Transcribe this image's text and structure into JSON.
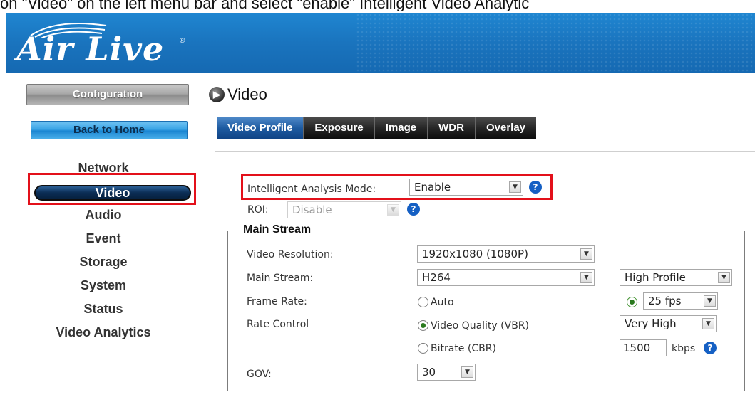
{
  "caption": "on \"Video\" on the left menu bar and select \"enable\" Intelligent Video Analytic",
  "brand": {
    "logo_text": "Air Live",
    "trademark": "®"
  },
  "sidebar": {
    "configuration_label": "Configuration",
    "back_home_label": "Back to Home",
    "items": [
      {
        "label": "Network"
      },
      {
        "label": "Video"
      },
      {
        "label": "Audio"
      },
      {
        "label": "Event"
      },
      {
        "label": "Storage"
      },
      {
        "label": "System"
      },
      {
        "label": "Status"
      },
      {
        "label": "Video Analytics"
      }
    ]
  },
  "page": {
    "title": "Video",
    "tabs": [
      {
        "label": "Video Profile"
      },
      {
        "label": "Exposure"
      },
      {
        "label": "Image"
      },
      {
        "label": "WDR"
      },
      {
        "label": "Overlay"
      }
    ]
  },
  "form": {
    "intelligent_label": "Intelligent Analysis Mode:",
    "intelligent_value": "Enable",
    "roi_label": "ROI:",
    "roi_value": "Disable",
    "main_stream_legend": "Main Stream",
    "resolution_label": "Video Resolution:",
    "resolution_value": "1920x1080 (1080P)",
    "main_stream_label": "Main Stream:",
    "codec_value": "H264",
    "profile_value": "High Profile",
    "frame_rate_label": "Frame Rate:",
    "frame_rate_auto": "Auto",
    "frame_rate_value": "25 fps",
    "rate_control_label": "Rate Control",
    "vbr_label": "Video Quality (VBR)",
    "vbr_value": "Very High",
    "cbr_label": "Bitrate (CBR)",
    "bitrate_value": "1500",
    "bitrate_unit": "kbps",
    "gov_label": "GOV:",
    "gov_value": "30"
  },
  "colors": {
    "banner": "#1a74be",
    "highlight": "#e3101a",
    "active_tab": "#1e5ba1"
  }
}
